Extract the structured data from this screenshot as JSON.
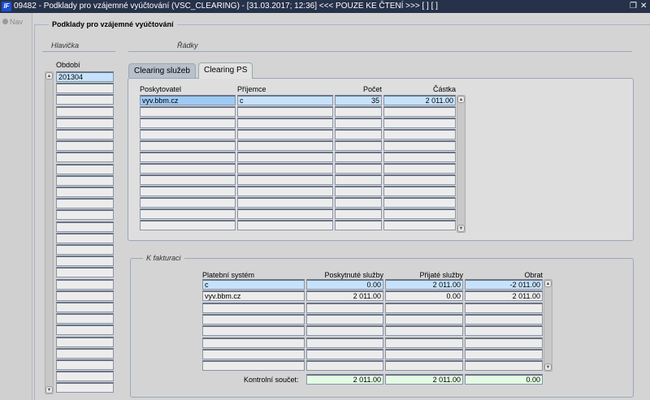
{
  "window": {
    "title": "09482 - Podklady pro vzájemné vyúčtování (VSC_CLEARING) - [31.03.2017; 12:36] <<< POUZE KE ČTENÍ >>> [ ] [ ]",
    "logo": "IF",
    "restore_icon": "restore-icon",
    "close_icon": "close-icon"
  },
  "nav": {
    "label": "Nav"
  },
  "form": {
    "title": "Podklady pro vzájemné vyúčtování"
  },
  "header_section": {
    "label": "Hlavička",
    "column": "Období",
    "rows": [
      "201304"
    ]
  },
  "rows_section": {
    "label": "Řádky",
    "tabs": [
      {
        "label": "Clearing služeb",
        "active": false
      },
      {
        "label": "Clearing PS",
        "active": true
      }
    ],
    "columns": [
      "Poskytovatel",
      "Příjemce",
      "Počet",
      "Částka"
    ],
    "rows": [
      [
        "vyv.bbm.cz",
        "c",
        "35",
        "2 011.00"
      ]
    ]
  },
  "invoice_section": {
    "label": "K fakturaci",
    "columns": [
      "Platební systém",
      "Poskytnuté služby",
      "Přijaté  služby",
      "Obrat"
    ],
    "rows": [
      [
        "c",
        "0.00",
        "2 011.00",
        "-2 011.00"
      ],
      [
        "vyv.bbm.cz",
        "2 011.00",
        "0.00",
        "2 011.00"
      ]
    ],
    "total_label": "Kontrolní součet:",
    "totals": [
      "2 011.00",
      "2 011.00",
      "0.00"
    ]
  }
}
